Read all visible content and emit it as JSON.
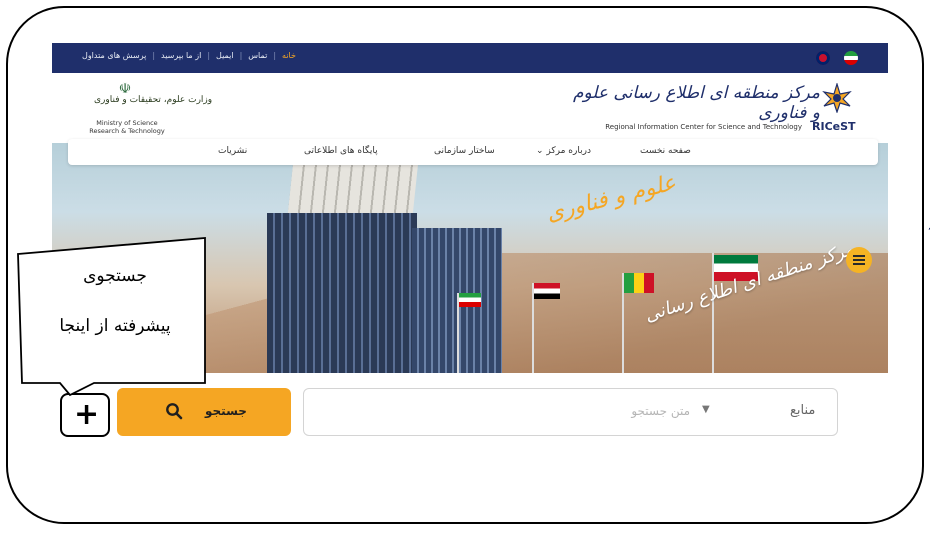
{
  "topbar": {
    "links": [
      "پرسش های متداول",
      "از ما بپرسید",
      "ایمیل",
      "تماس",
      "خانه"
    ]
  },
  "header": {
    "logo_fa": "مرکز منطقه ای اطلاع رسانی علوم و فناوری",
    "logo_en": "Regional Information Center for Science and Technology",
    "logo_abbr": "RICeST",
    "ministry_fa": "وزارت علوم، تحقیقات و فناوری",
    "ministry_en_line1": "Ministry of Science",
    "ministry_en_line2": "Research & Technology"
  },
  "nav": {
    "items": [
      "صفحه نخست",
      "درباره مرکز",
      "ساختار سازمانی",
      "پایگاه های اطلاعاتی",
      "نشریات"
    ]
  },
  "hero": {
    "title1": "علوم و فناوری",
    "title2": "مرکز منطقه ای اطلاع رسانی"
  },
  "search": {
    "source_label": "منابع",
    "placeholder": "متن جستجو",
    "button_label": "جستجو",
    "plus_symbol": "+"
  },
  "callout": {
    "line1": "جستجوی",
    "line2": "پیشرفته از اینجا"
  },
  "colors": {
    "navy": "#1f2f6b",
    "accent": "#f5a623"
  }
}
